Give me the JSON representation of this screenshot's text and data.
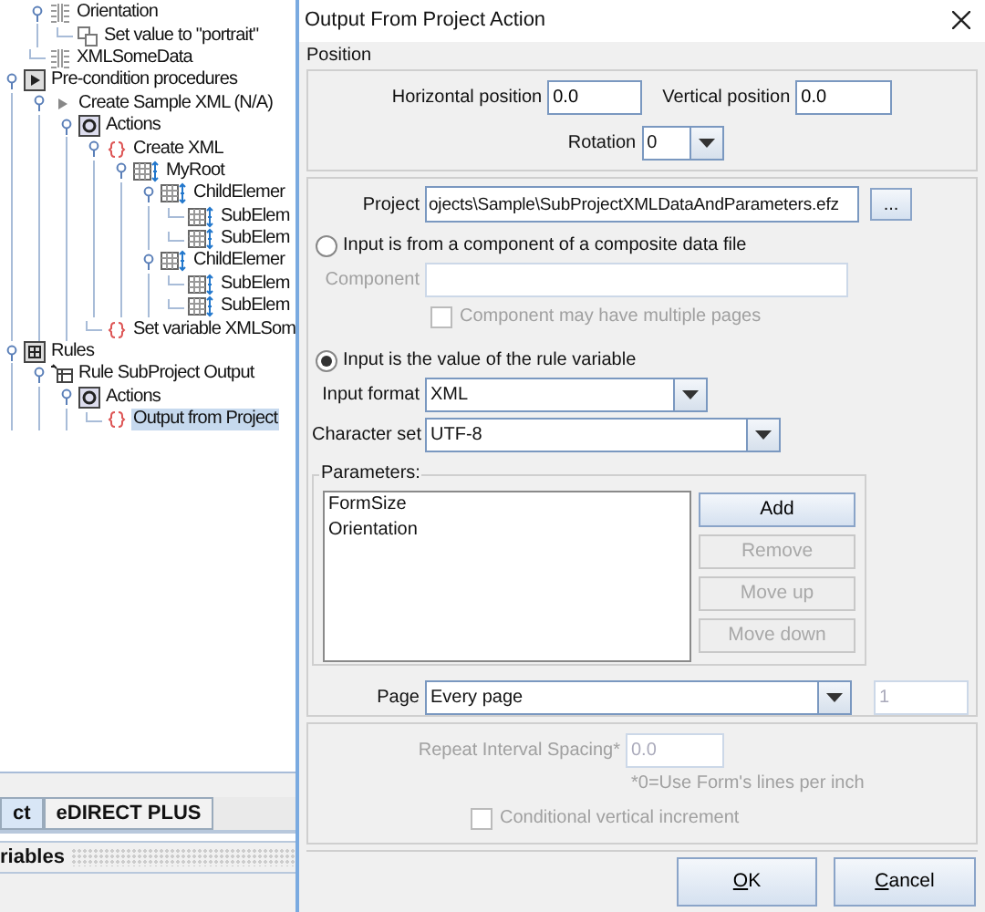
{
  "left_panel": {
    "tree": [
      {
        "children": [
          {
            "label": "Orientation",
            "kind": "param",
            "selected": false,
            "expanded": true,
            "children": [
              {
                "label": "Set value to \"portrait\"",
                "kind": "setvalue",
                "selected": false
              }
            ]
          },
          {
            "label": "XMLSomeData",
            "kind": "param",
            "selected": false
          }
        ]
      },
      {
        "label": "Pre-condition procedures",
        "kind": "group",
        "selected": false,
        "expanded": true,
        "children": [
          {
            "label": "Create Sample XML (N/A)",
            "kind": "procedure",
            "selected": false,
            "expanded": true,
            "children": [
              {
                "label": "Actions",
                "kind": "actions",
                "selected": false,
                "expanded": true,
                "children": [
                  {
                    "label": "Create XML",
                    "kind": "action",
                    "selected": false,
                    "expanded": true,
                    "children": [
                      {
                        "label": "MyRoot",
                        "kind": "element",
                        "selected": false,
                        "expanded": true,
                        "children": [
                          {
                            "label": "ChildElemer",
                            "kind": "element",
                            "selected": false,
                            "expanded": true,
                            "children": [
                              {
                                "label": "SubElem",
                                "kind": "element",
                                "selected": false
                              },
                              {
                                "label": "SubElem",
                                "kind": "element",
                                "selected": false
                              }
                            ]
                          },
                          {
                            "label": "ChildElemer",
                            "kind": "element",
                            "selected": false,
                            "expanded": true,
                            "children": [
                              {
                                "label": "SubElem",
                                "kind": "element",
                                "selected": false
                              },
                              {
                                "label": "SubElem",
                                "kind": "element",
                                "selected": false
                              }
                            ]
                          }
                        ]
                      }
                    ]
                  },
                  {
                    "label": "Set variable XMLSom",
                    "kind": "action",
                    "selected": false
                  }
                ]
              }
            ]
          }
        ]
      },
      {
        "label": "Rules",
        "kind": "rules",
        "selected": false,
        "expanded": true,
        "children": [
          {
            "label": "Rule SubProject Output",
            "kind": "rule",
            "selected": false,
            "expanded": true,
            "children": [
              {
                "label": "Actions",
                "kind": "actions",
                "selected": false,
                "expanded": true,
                "children": [
                  {
                    "label": "Output from Project",
                    "kind": "action",
                    "selected": true
                  }
                ]
              }
            ]
          }
        ]
      }
    ],
    "tabs": [
      {
        "label": "ct",
        "selected": true
      },
      {
        "label": "eDIRECT PLUS",
        "selected": false
      }
    ],
    "variables_bar": {
      "label": "riables"
    }
  },
  "dialog": {
    "title": "Output From Project Action",
    "section_title": "Position",
    "position": {
      "horizontal_label": "Horizontal position",
      "horizontal_value": "0.0",
      "vertical_label": "Vertical position",
      "vertical_value": "0.0",
      "rotation_label": "Rotation",
      "rotation_value": "0"
    },
    "project": {
      "label": "Project",
      "value": "ojects\\Sample\\SubProjectXMLDataAndParameters.efz",
      "browse": "..."
    },
    "component_option": {
      "label": "Input is from a component of a composite data file",
      "selected": false
    },
    "component_field": {
      "label": "Component",
      "disabled": true
    },
    "multiple_pages": {
      "label": "Component may have multiple pages",
      "checked": false,
      "disabled": true
    },
    "variable_option": {
      "label": "Input is the value of the rule variable",
      "selected": true
    },
    "input_format": {
      "label": "Input format",
      "value": "XML"
    },
    "character_set": {
      "label": "Character set",
      "value": "UTF-8"
    },
    "parameters": {
      "title": "Parameters:",
      "items": [
        "FormSize",
        "Orientation"
      ],
      "buttons": [
        {
          "label": "Add",
          "disabled": false
        },
        {
          "label": "Remove",
          "disabled": true
        },
        {
          "label": "Move up",
          "disabled": true
        },
        {
          "label": "Move down",
          "disabled": true
        }
      ]
    },
    "page": {
      "label": "Page",
      "value": "Every page",
      "number": "1",
      "number_disabled": true
    },
    "repeat": {
      "label": "Repeat Interval Spacing*",
      "value": "0.0",
      "note": "*0=Use Form's lines per inch",
      "disabled": true
    },
    "conditional": {
      "label": "Conditional vertical increment",
      "checked": false,
      "disabled": true
    },
    "buttons": [
      {
        "label": "OK",
        "underline_first": true
      },
      {
        "label": "Cancel",
        "underline_first": true
      }
    ]
  }
}
